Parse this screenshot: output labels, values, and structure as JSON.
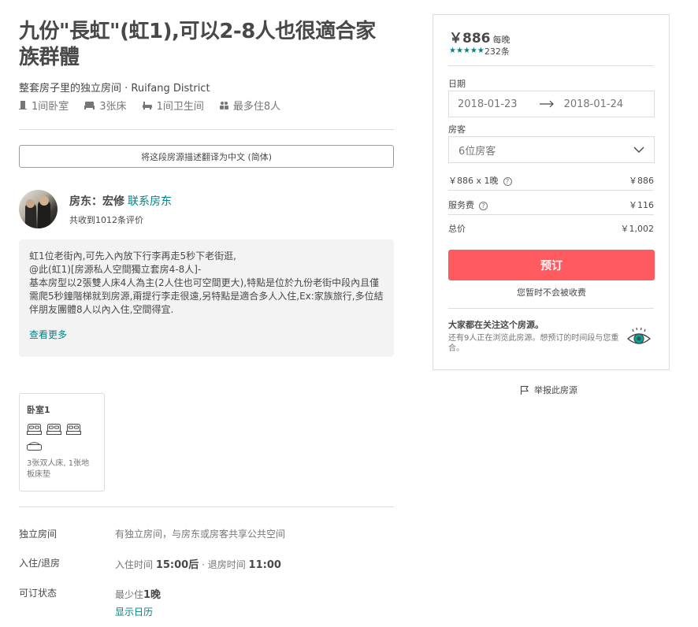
{
  "listing": {
    "title": "九份\"長虹\"(虹1),可以2-8人也很適合家族群體",
    "subtitle": "整套房子里的独立房间 · Ruifang District",
    "facts": [
      {
        "icon": "door-icon",
        "label": "1间卧室"
      },
      {
        "icon": "bed-icon",
        "label": "3张床"
      },
      {
        "icon": "bath-icon",
        "label": "1间卫生间"
      },
      {
        "icon": "guests-icon",
        "label": "最多住8人"
      }
    ]
  },
  "translate_button": "将这段房源描述翻译为中文 (简体)",
  "host": {
    "prefix": "房东：宏修",
    "contact": "联系房东",
    "reviews": "共收到1012条评价"
  },
  "description": {
    "text": "虹1位老街內,可先入內放下行李再走5秒下老街逛,\n@此(虹1)[房源私人空間獨立套房4-8人]-\n基本房型以2張雙人床4人為主(2人住也可空間更大),特點是位於九份老街中段內且僅需爬5秒鐘階梯就到房源,甭提行李走很遠,另特點是適合多人入住,Ex:家族旅行,多位結伴朋友團體8人以內入住,空間得宜.",
    "read_more": "查看更多"
  },
  "bedroom": {
    "title": "卧室1",
    "beds": "3张双人床, 1张地板床垫"
  },
  "details": [
    {
      "label": "独立房间",
      "value": "有独立房间，与房东或房客共享公共空间"
    },
    {
      "label": "入住/退房",
      "checkin_label": "入住时间",
      "checkin": "15:00后",
      "checkout_label": "· 退房时间",
      "checkout": "11:00"
    },
    {
      "label": "可订状态",
      "min_label": "最少住",
      "min": "1晚",
      "calendar": "显示日历"
    }
  ],
  "booking": {
    "price": "￥886",
    "per_night": "每晚",
    "review_count": "232条",
    "dates_label": "日期",
    "checkin": "2018-01-23",
    "checkout": "2018-01-24",
    "guests_label": "房客",
    "guests": "6位房客",
    "line_items": [
      {
        "label": "￥886 x 1晚",
        "amount": "￥886"
      },
      {
        "label": "服务费",
        "amount": "￥116"
      },
      {
        "label": "总价",
        "amount": "￥1,002"
      }
    ],
    "book_label": "预订",
    "no_charge": "您暂时不会被收费",
    "notice_title": "大家都在关注这个房源。",
    "notice_text": "还有9人正在浏览此房源。想预订的时间段与您重合。"
  },
  "report": "举报此房源",
  "colors": {
    "accent": "#ff5a5f",
    "link": "#008489",
    "text": "#484848",
    "muted": "#767676"
  }
}
